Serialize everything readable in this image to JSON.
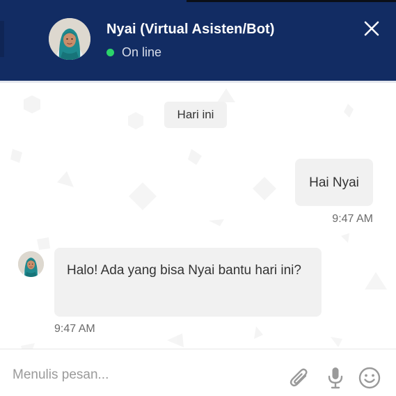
{
  "header": {
    "bot_name": "Nyai (Virtual Asisten/Bot)",
    "status_label": "On line",
    "avatar_icon": "woman-hijab-avatar-icon",
    "close_icon": "close-icon"
  },
  "chat": {
    "date_label": "Hari ini",
    "messages": [
      {
        "direction": "outgoing",
        "text": "Hai Nyai",
        "time": "9:47 AM"
      },
      {
        "direction": "incoming",
        "text": "Halo! Ada yang bisa Nyai bantu hari ini?",
        "time": "9:47 AM"
      }
    ]
  },
  "composer": {
    "placeholder": "Menulis pesan...",
    "value": "",
    "attach_icon": "paperclip-icon",
    "mic_icon": "microphone-icon",
    "emoji_icon": "emoji-icon"
  },
  "colors": {
    "header_bg": "#122c63",
    "status_online": "#2bd46a",
    "bubble_bg": "#f1f1f1",
    "chat_bg": "#ffffff"
  }
}
